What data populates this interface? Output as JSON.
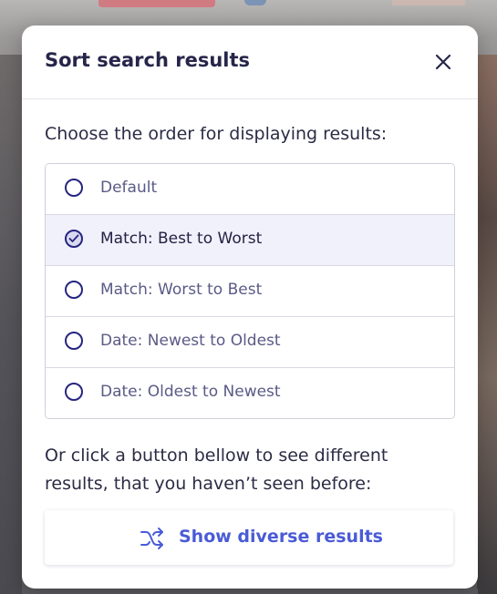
{
  "modal": {
    "title": "Sort search results",
    "prompt": "Choose the order for displaying results:",
    "options": [
      {
        "label": "Default",
        "selected": false
      },
      {
        "label": "Match: Best to Worst",
        "selected": true
      },
      {
        "label": "Match: Worst to Best",
        "selected": false
      },
      {
        "label": "Date: Newest to Oldest",
        "selected": false
      },
      {
        "label": "Date: Oldest to Newest",
        "selected": false
      }
    ],
    "note_line1": "Or click a button bellow to see different",
    "note_line2": "results, that you haven’t seen before:",
    "diverse_button_label": "Show diverse results",
    "close_icon": "close-icon",
    "diverse_icon": "shuffle-icon"
  },
  "colors": {
    "title": "#26264a",
    "radio": "#262680",
    "selected_row": "#f1f1fb",
    "accent": "#4a5bd6"
  }
}
